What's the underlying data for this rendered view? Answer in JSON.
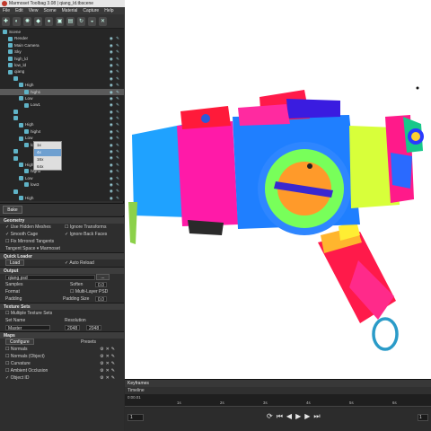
{
  "window": {
    "title": "Marmoset Toolbag 3.08  |  qiang_ld.tbscene"
  },
  "menu": [
    "File",
    "Edit",
    "View",
    "Scene",
    "Material",
    "Capture",
    "Help"
  ],
  "tree": [
    {
      "label": "Scene",
      "indent": 0,
      "flags": ""
    },
    {
      "label": "Render",
      "indent": 1,
      "flags": "◉ ✎"
    },
    {
      "label": "Main Camera",
      "indent": 1,
      "flags": "◉ ✎"
    },
    {
      "label": "Sky",
      "indent": 1,
      "flags": "◉ ✎"
    },
    {
      "label": "high_ld",
      "indent": 1,
      "flags": "◉ ✎"
    },
    {
      "label": "low_ld",
      "indent": 1,
      "flags": "◉ ✎"
    },
    {
      "label": "qiang",
      "indent": 1,
      "flags": "◉ ✎"
    },
    {
      "label": "",
      "indent": 2,
      "flags": "◉ ✎"
    },
    {
      "label": "High",
      "indent": 3,
      "flags": "◉ ✎"
    },
    {
      "label": "high1",
      "indent": 4,
      "flags": "◉ ✎",
      "selected": true
    },
    {
      "label": "Low",
      "indent": 3,
      "flags": "◉ ✎"
    },
    {
      "label": "Low1",
      "indent": 4,
      "flags": "◉ ✎"
    },
    {
      "label": "",
      "indent": 2,
      "flags": "◉ ✎"
    },
    {
      "label": "",
      "indent": 2,
      "flags": "◉ ✎"
    },
    {
      "label": "High",
      "indent": 3,
      "flags": "◉ ✎"
    },
    {
      "label": "high4",
      "indent": 4,
      "flags": "◉ ✎"
    },
    {
      "label": "Low",
      "indent": 3,
      "flags": "◉ ✎"
    },
    {
      "label": "low24",
      "indent": 4,
      "flags": "◉ ✎"
    },
    {
      "label": "",
      "indent": 2,
      "flags": "◉ ✎"
    },
    {
      "label": "",
      "indent": 2,
      "flags": "◉ ✎"
    },
    {
      "label": "High",
      "indent": 3,
      "flags": "◉ ✎"
    },
    {
      "label": "high3",
      "indent": 4,
      "flags": "◉ ✎"
    },
    {
      "label": "Low",
      "indent": 3,
      "flags": "◉ ✎"
    },
    {
      "label": "low3",
      "indent": 4,
      "flags": "◉ ✎"
    },
    {
      "label": "",
      "indent": 2,
      "flags": "◉ ✎"
    },
    {
      "label": "High",
      "indent": 3,
      "flags": "◉ ✎"
    }
  ],
  "bake_button": "Bake",
  "geometry": {
    "header": "Geometry",
    "use_hidden_meshes": "Use Hidden Meshes",
    "ignore_transforms": "Ignore Transforms",
    "smooth_cage": "Smooth Cage",
    "ignore_back_faces": "Ignore Back Faces",
    "fix_mirrored_tangents": "Fix Mirrored Tangents",
    "tangent_space_label": "Tangent Space",
    "tangent_space_value": "Marmoset"
  },
  "quick_loader": {
    "header": "Quick Loader",
    "load_button": "Load",
    "auto_reload": "Auto Reload"
  },
  "output": {
    "header": "Output",
    "file_name": "qiang.psd",
    "browse": "...",
    "samples_label": "Samples",
    "softness_label": "Soften",
    "softness_value": "0.0",
    "format_label": "Format",
    "multi_layer_psd": "Multi-Layer PSD",
    "padding_label": "Padding",
    "padding_size_label": "Padding Size",
    "padding_size_value": "0.0",
    "sample_options": [
      "1x",
      "4x",
      "16x",
      "64x"
    ]
  },
  "texture_sets": {
    "header": "Texture Sets",
    "multiple": "Multiple Texture Sets",
    "set_name_label": "Set Name",
    "resolution_label": "Resolution",
    "set_name_value": "Master",
    "res_w": "2048",
    "res_h": "2048"
  },
  "maps": {
    "header": "Maps",
    "configure_button": "Configure",
    "presets_label": "Presets",
    "items": [
      {
        "label": "Normals",
        "checked": false
      },
      {
        "label": "Normals (Object)",
        "checked": false
      },
      {
        "label": "Curvature",
        "checked": false
      },
      {
        "label": "Ambient Occlusion",
        "checked": false
      },
      {
        "label": "Object ID",
        "checked": true
      }
    ]
  },
  "timeline": {
    "title": "Keyframes",
    "subtitle": "Timeline",
    "ticks": [
      "0s",
      "1s",
      "2s",
      "3s",
      "4s",
      "5s",
      "6s"
    ],
    "time_readout": "0:00.01",
    "frame_value": "1",
    "end_value": "1"
  }
}
